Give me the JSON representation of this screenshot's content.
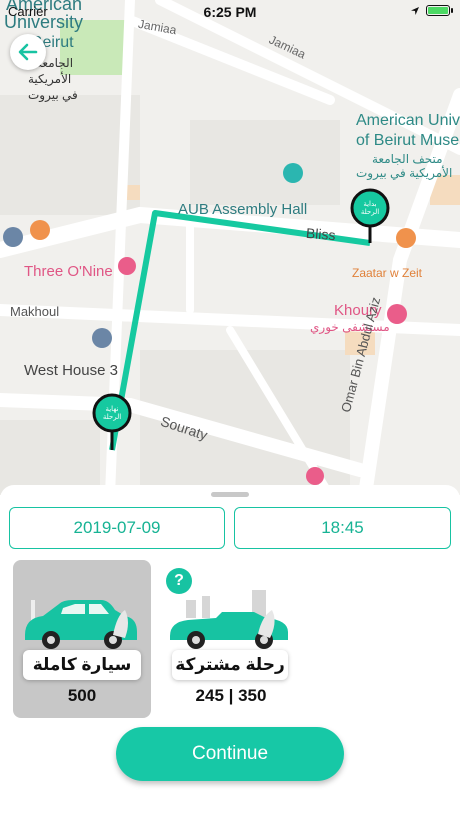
{
  "status_bar": {
    "carrier": "Carrier",
    "time": "6:25 PM"
  },
  "map": {
    "labels": {
      "american_university": "American",
      "university": "University",
      "of_beirut": "of Beirut",
      "arabic_aub_1": "الجامعة",
      "arabic_aub_2": "الأمريكية",
      "arabic_aub_3": "في بيروت",
      "jamiaa_1": "Jamiaa",
      "jamiaa_2": "Jamiaa",
      "museum_1": "American Unive",
      "museum_2": "of Beirut Museu",
      "museum_ar_1": "متحف الجامعة",
      "museum_ar_2": "الأمريكية في بيروت",
      "assembly_hall": "AUB Assembly Hall",
      "bliss": "Bliss",
      "three_o_nine": "Three O'Nine",
      "zaatar": "Zaatar w Zeit",
      "makhoul": "Makhoul",
      "khoury": "Khoury",
      "khoury_ar": "مستشفى خوري",
      "west_house": "West House 3",
      "souraty": "Souraty",
      "omar_bin": "Omar Bin Abdul Aziz",
      "start_pin": "بداية الرحلة",
      "end_pin": "نهاية الرحلة"
    }
  },
  "booking": {
    "date": "2019-07-09",
    "time": "18:45",
    "options": [
      {
        "label": "سيارة كاملة",
        "price": "500"
      },
      {
        "label": "رحلة مشتركة",
        "price": "245 | 350",
        "help": "?"
      }
    ],
    "continue_label": "Continue"
  },
  "colors": {
    "accent": "#17c3a2",
    "route": "#16c9a0",
    "selected_bg": "#c7c7c7"
  }
}
